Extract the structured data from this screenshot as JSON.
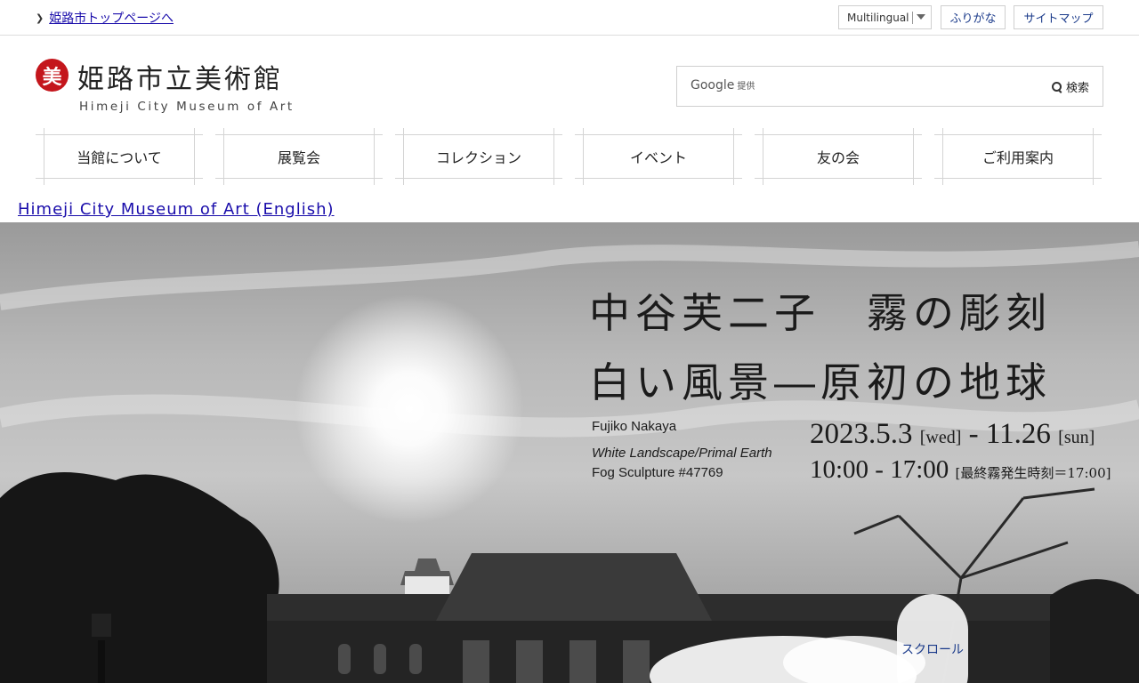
{
  "topbar": {
    "city_top_link": "姫路市トップページへ",
    "language_select": "Multilingual",
    "furigana_button": "ふりがな",
    "sitemap_button": "サイトマップ"
  },
  "header": {
    "logo_mark": "美",
    "logo_japanese": "姫路市立美術館",
    "logo_english": "Himeji City Museum of Art",
    "search_brand": "Google",
    "search_provided": "提供",
    "search_button": "検索"
  },
  "nav": {
    "items": [
      "当館について",
      "展覧会",
      "コレクション",
      "イベント",
      "友の会",
      "ご利用案内"
    ]
  },
  "english_link": "Himeji City Museum of Art (English)",
  "hero": {
    "title_line1": "中谷芙二子　霧の彫刻",
    "title_line2": "白い風景―原初の地球",
    "artist": "Fujiko Nakaya",
    "subtitle": "White Landscape/Primal Earth",
    "work": "Fog Sculpture #47769",
    "date_start": "2023.5.3",
    "day_start": "[wed]",
    "date_sep": " - ",
    "date_end": "11.26",
    "day_end": "[sun]",
    "hours": "10:00 - 17:00",
    "hours_note": "[最終霧発生時刻＝17:00]",
    "scroll_label": "スクロール"
  }
}
